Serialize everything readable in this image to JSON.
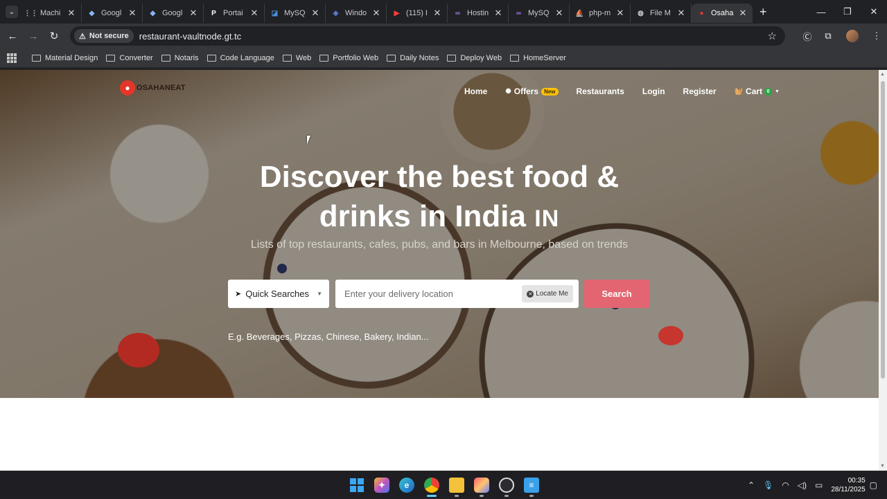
{
  "browser": {
    "tabs": [
      {
        "label": "Machi",
        "fav": "⋮⋮",
        "color": "#c8cacf"
      },
      {
        "label": "Googl",
        "fav": "◆",
        "color": "#8ab4f8"
      },
      {
        "label": "Googl",
        "fav": "◆",
        "color": "#8ab4f8"
      },
      {
        "label": "Portai",
        "fav": "P",
        "color": "#ffffff"
      },
      {
        "label": "MySQ",
        "fav": "◪",
        "color": "#4a8fd6"
      },
      {
        "label": "Windo",
        "fav": "◈",
        "color": "#5b7bd5"
      },
      {
        "label": "(115) I",
        "fav": "▶",
        "color": "#ff3d3d"
      },
      {
        "label": "Hostin",
        "fav": "∞",
        "color": "#a678f2"
      },
      {
        "label": "MySQ",
        "fav": "∞",
        "color": "#a678f2"
      },
      {
        "label": "php-m",
        "fav": "⛵",
        "color": "#e0a040"
      },
      {
        "label": "File M",
        "fav": "◍",
        "color": "#c8cacf"
      },
      {
        "label": "Osaha",
        "fav": "●",
        "color": "#e6352b"
      }
    ],
    "security_label": "Not secure",
    "url": "restaurant-vaultnode.gt.tc",
    "bookmarks": [
      "Material Design",
      "Converter",
      "Notaris",
      "Code Language",
      "Web",
      "Portfolio Web",
      "Daily Notes",
      "Deploy Web",
      "HomeServer"
    ]
  },
  "site": {
    "logo_text": "OSAHANEAT",
    "nav": {
      "home": "Home",
      "offers": "Offers",
      "offers_badge": "New",
      "restaurants": "Restaurants",
      "login": "Login",
      "register": "Register",
      "cart": "Cart",
      "cart_count": "0"
    },
    "headline_line1": "Discover the best food &",
    "headline_line2": "drinks in India",
    "headline_flag": "IN",
    "subline": "Lists of top restaurants, cafes, pubs, and bars in Melbourne, based on trends",
    "quick_searches": "Quick Searches",
    "location_placeholder": "Enter your delivery location",
    "locate_me": "Locate Me",
    "search_button": "Search",
    "examples": "E.g. Beverages, Pizzas, Chinese, Bakery, Indian..."
  },
  "taskbar": {
    "time": "00:35",
    "date": "28/11/2025"
  },
  "colors": {
    "accent": "#e36571",
    "brand": "#e6352b",
    "badge": "#ffc107"
  }
}
